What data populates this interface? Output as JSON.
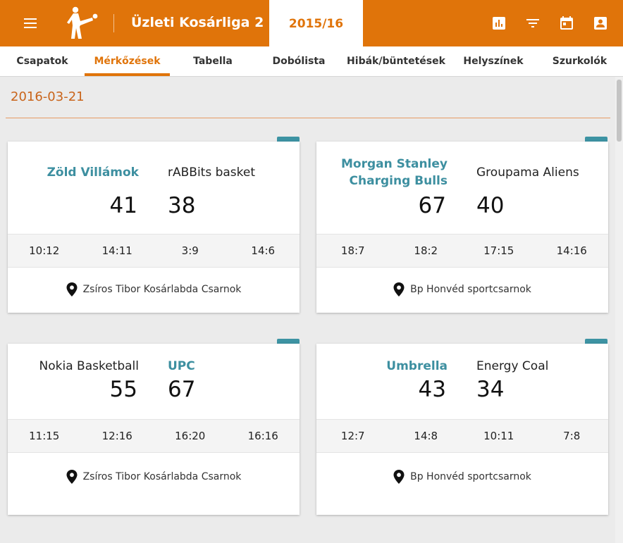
{
  "app": {
    "title": "Üzleti Kosárliga 2",
    "season": "2015/16"
  },
  "icons": {
    "menu": "menu-icon",
    "logo": "player-kicking-logo",
    "stats": "bar-chart-icon",
    "filter": "filter-icon",
    "calendar": "calendar-icon",
    "account": "account-box-icon",
    "location": "location-pin-icon"
  },
  "colors": {
    "primary": "#e0740a",
    "winner": "#3d8fa0",
    "tag": "#3d93a3"
  },
  "tabs": [
    {
      "label": "Csapatok",
      "active": false
    },
    {
      "label": "Mérkőzések",
      "active": true
    },
    {
      "label": "Tabella",
      "active": false
    },
    {
      "label": "Dobólista",
      "active": false
    },
    {
      "label": "Hibák/büntetések",
      "active": false
    },
    {
      "label": "Helyszínek",
      "active": false
    },
    {
      "label": "Szurkolók",
      "active": false
    }
  ],
  "date": "2016-03-21",
  "matches": [
    {
      "home": "Zöld Villámok",
      "away": "rABBits basket",
      "home_score": "41",
      "away_score": "38",
      "winner": "home",
      "quarters": [
        "10:12",
        "14:11",
        "3:9",
        "14:6"
      ],
      "venue": "Zsíros Tibor Kosárlabda Csarnok"
    },
    {
      "home": "Morgan Stanley Charging Bulls",
      "away": "Groupama Aliens",
      "home_score": "67",
      "away_score": "40",
      "winner": "home",
      "quarters": [
        "18:7",
        "18:2",
        "17:15",
        "14:16"
      ],
      "venue": "Bp Honvéd sportcsarnok"
    },
    {
      "home": "Nokia Basketball",
      "away": "UPC",
      "home_score": "55",
      "away_score": "67",
      "winner": "away",
      "quarters": [
        "11:15",
        "12:16",
        "16:20",
        "16:16"
      ],
      "venue": "Zsíros Tibor Kosárlabda Csarnok"
    },
    {
      "home": "Umbrella",
      "away": "Energy Coal",
      "home_score": "43",
      "away_score": "34",
      "winner": "home",
      "quarters": [
        "12:7",
        "14:8",
        "10:11",
        "7:8"
      ],
      "venue": "Bp Honvéd sportcsarnok"
    }
  ]
}
